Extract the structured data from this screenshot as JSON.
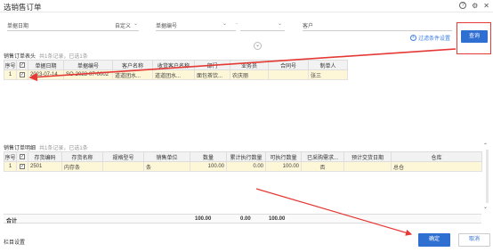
{
  "dialog": {
    "title": "选销售订单"
  },
  "filters": {
    "date_label": "单据日期",
    "date_value": "自定义",
    "doc_no_label": "单据编号",
    "customer_label": "客户",
    "filter_settings": "过滤条件设置",
    "query_button": "查询"
  },
  "header_section": {
    "label": "销售订单表头",
    "sub": "共1条记录，已选1条",
    "columns": [
      "序号",
      "",
      "单据日期",
      "单据编号",
      "客户名称",
      "收货客户名称",
      "部门",
      "业务员",
      "合同号",
      "制单人"
    ],
    "rows": [
      {
        "index": "1",
        "checked": true,
        "date": "2023-07-14",
        "doc_no": "SO-2023-07-0002",
        "customer": "道道团水...",
        "receiver": "道道团水...",
        "dept": "面包茶饮...",
        "salesman": "农庆丽",
        "contract": "",
        "creator": "张三"
      }
    ]
  },
  "detail_section": {
    "label": "销售订单明细",
    "sub": "共1条记录，已选1条",
    "columns": [
      "序号",
      "",
      "存货编码",
      "存货名称",
      "规格型号",
      "销售单位",
      "数量",
      "累计执行数量",
      "可执行数量",
      "已采购需求...",
      "预计交货日期",
      "仓库"
    ],
    "rows": [
      {
        "index": "1",
        "checked": true,
        "code": "2501",
        "name": "内存条",
        "spec": "",
        "unit": "条",
        "qty": "100.00",
        "executed": "0.00",
        "executable": "100.00",
        "purchased": "否",
        "delivery": "",
        "warehouse": "总仓"
      }
    ]
  },
  "totals": {
    "label": "合计",
    "qty": "100.00",
    "executed": "0.00",
    "executable": "100.00"
  },
  "footer": {
    "column_settings": "栏目设置",
    "ok": "确定",
    "cancel": "取消"
  },
  "colors": {
    "primary": "#2f6fd1",
    "highlight_frame": "#e53935",
    "selected_row": "#fdf6d7"
  }
}
